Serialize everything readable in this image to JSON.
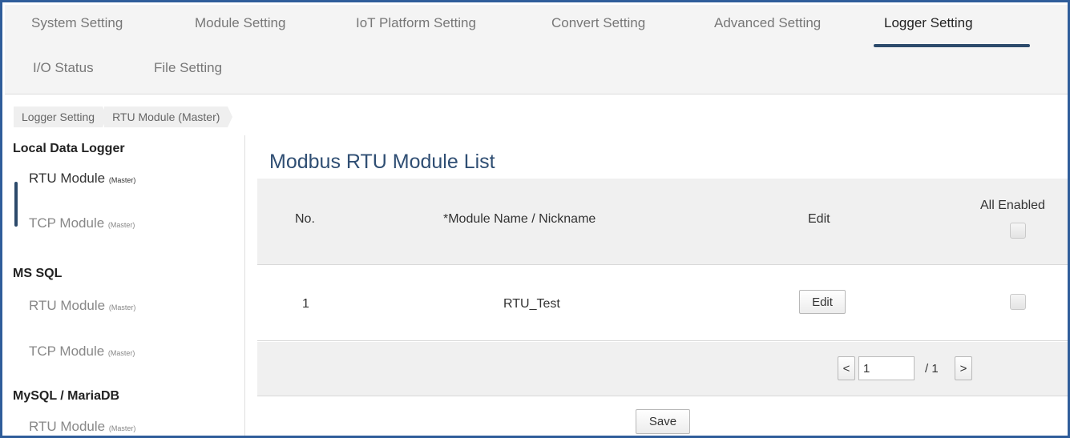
{
  "tabs": [
    {
      "label": "System Setting"
    },
    {
      "label": "Module Setting"
    },
    {
      "label": "IoT Platform Setting"
    },
    {
      "label": "Convert Setting"
    },
    {
      "label": "Advanced Setting"
    },
    {
      "label": "Logger Setting",
      "active": true
    },
    {
      "label": "I/O Status"
    },
    {
      "label": "File Setting"
    }
  ],
  "breadcrumb": [
    "Logger Setting",
    "RTU Module (Master)"
  ],
  "sidebar": {
    "groups": [
      {
        "title": "Local Data Logger",
        "items": [
          {
            "label": "RTU Module",
            "sub": "(Master)",
            "active": true
          },
          {
            "label": "TCP Module",
            "sub": "(Master)"
          }
        ]
      },
      {
        "title": "MS SQL",
        "items": [
          {
            "label": "RTU Module",
            "sub": "(Master)"
          },
          {
            "label": "TCP Module",
            "sub": "(Master)"
          }
        ]
      },
      {
        "title": "MySQL / MariaDB",
        "items": [
          {
            "label": "RTU Module",
            "sub": "(Master)"
          }
        ]
      }
    ]
  },
  "main": {
    "title": "Modbus RTU Module List",
    "columns": {
      "no": "No.",
      "name": "*Module Name / Nickname",
      "edit": "Edit",
      "enabled": "All Enabled"
    },
    "rows": [
      {
        "no": "1",
        "name": "RTU_Test",
        "edit_label": "Edit"
      }
    ],
    "pager": {
      "prev": "<",
      "page": "1",
      "total": "/ 1",
      "next": ">"
    },
    "save_label": "Save"
  },
  "colors": {
    "frame": "#2f5d9a",
    "accent": "#2c4a6b",
    "title": "#2f4e73"
  }
}
